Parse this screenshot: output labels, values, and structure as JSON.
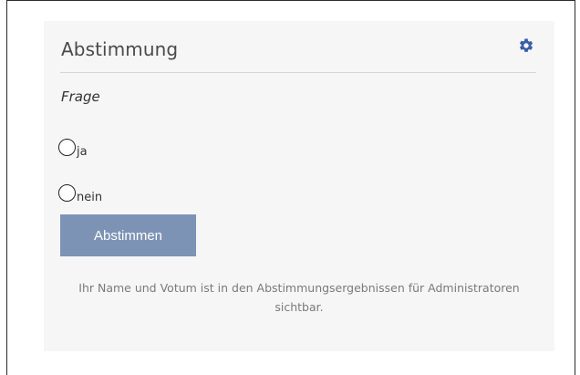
{
  "poll": {
    "title": "Abstimmung",
    "settings_icon": "gear-icon",
    "question": "Frage",
    "options": [
      {
        "label": "ja",
        "selected": false
      },
      {
        "label": "nein",
        "selected": false
      }
    ],
    "vote_button_label": "Abstimmen",
    "notice": "Ihr Name und Votum ist in den Abstimmungsergebnissen für Administratoren sichtbar."
  },
  "colors": {
    "panel_bg": "#f6f6f6",
    "button_bg": "#7d93b6",
    "gear_icon": "#3b5ea8",
    "notice_text": "#7a7a7a"
  }
}
